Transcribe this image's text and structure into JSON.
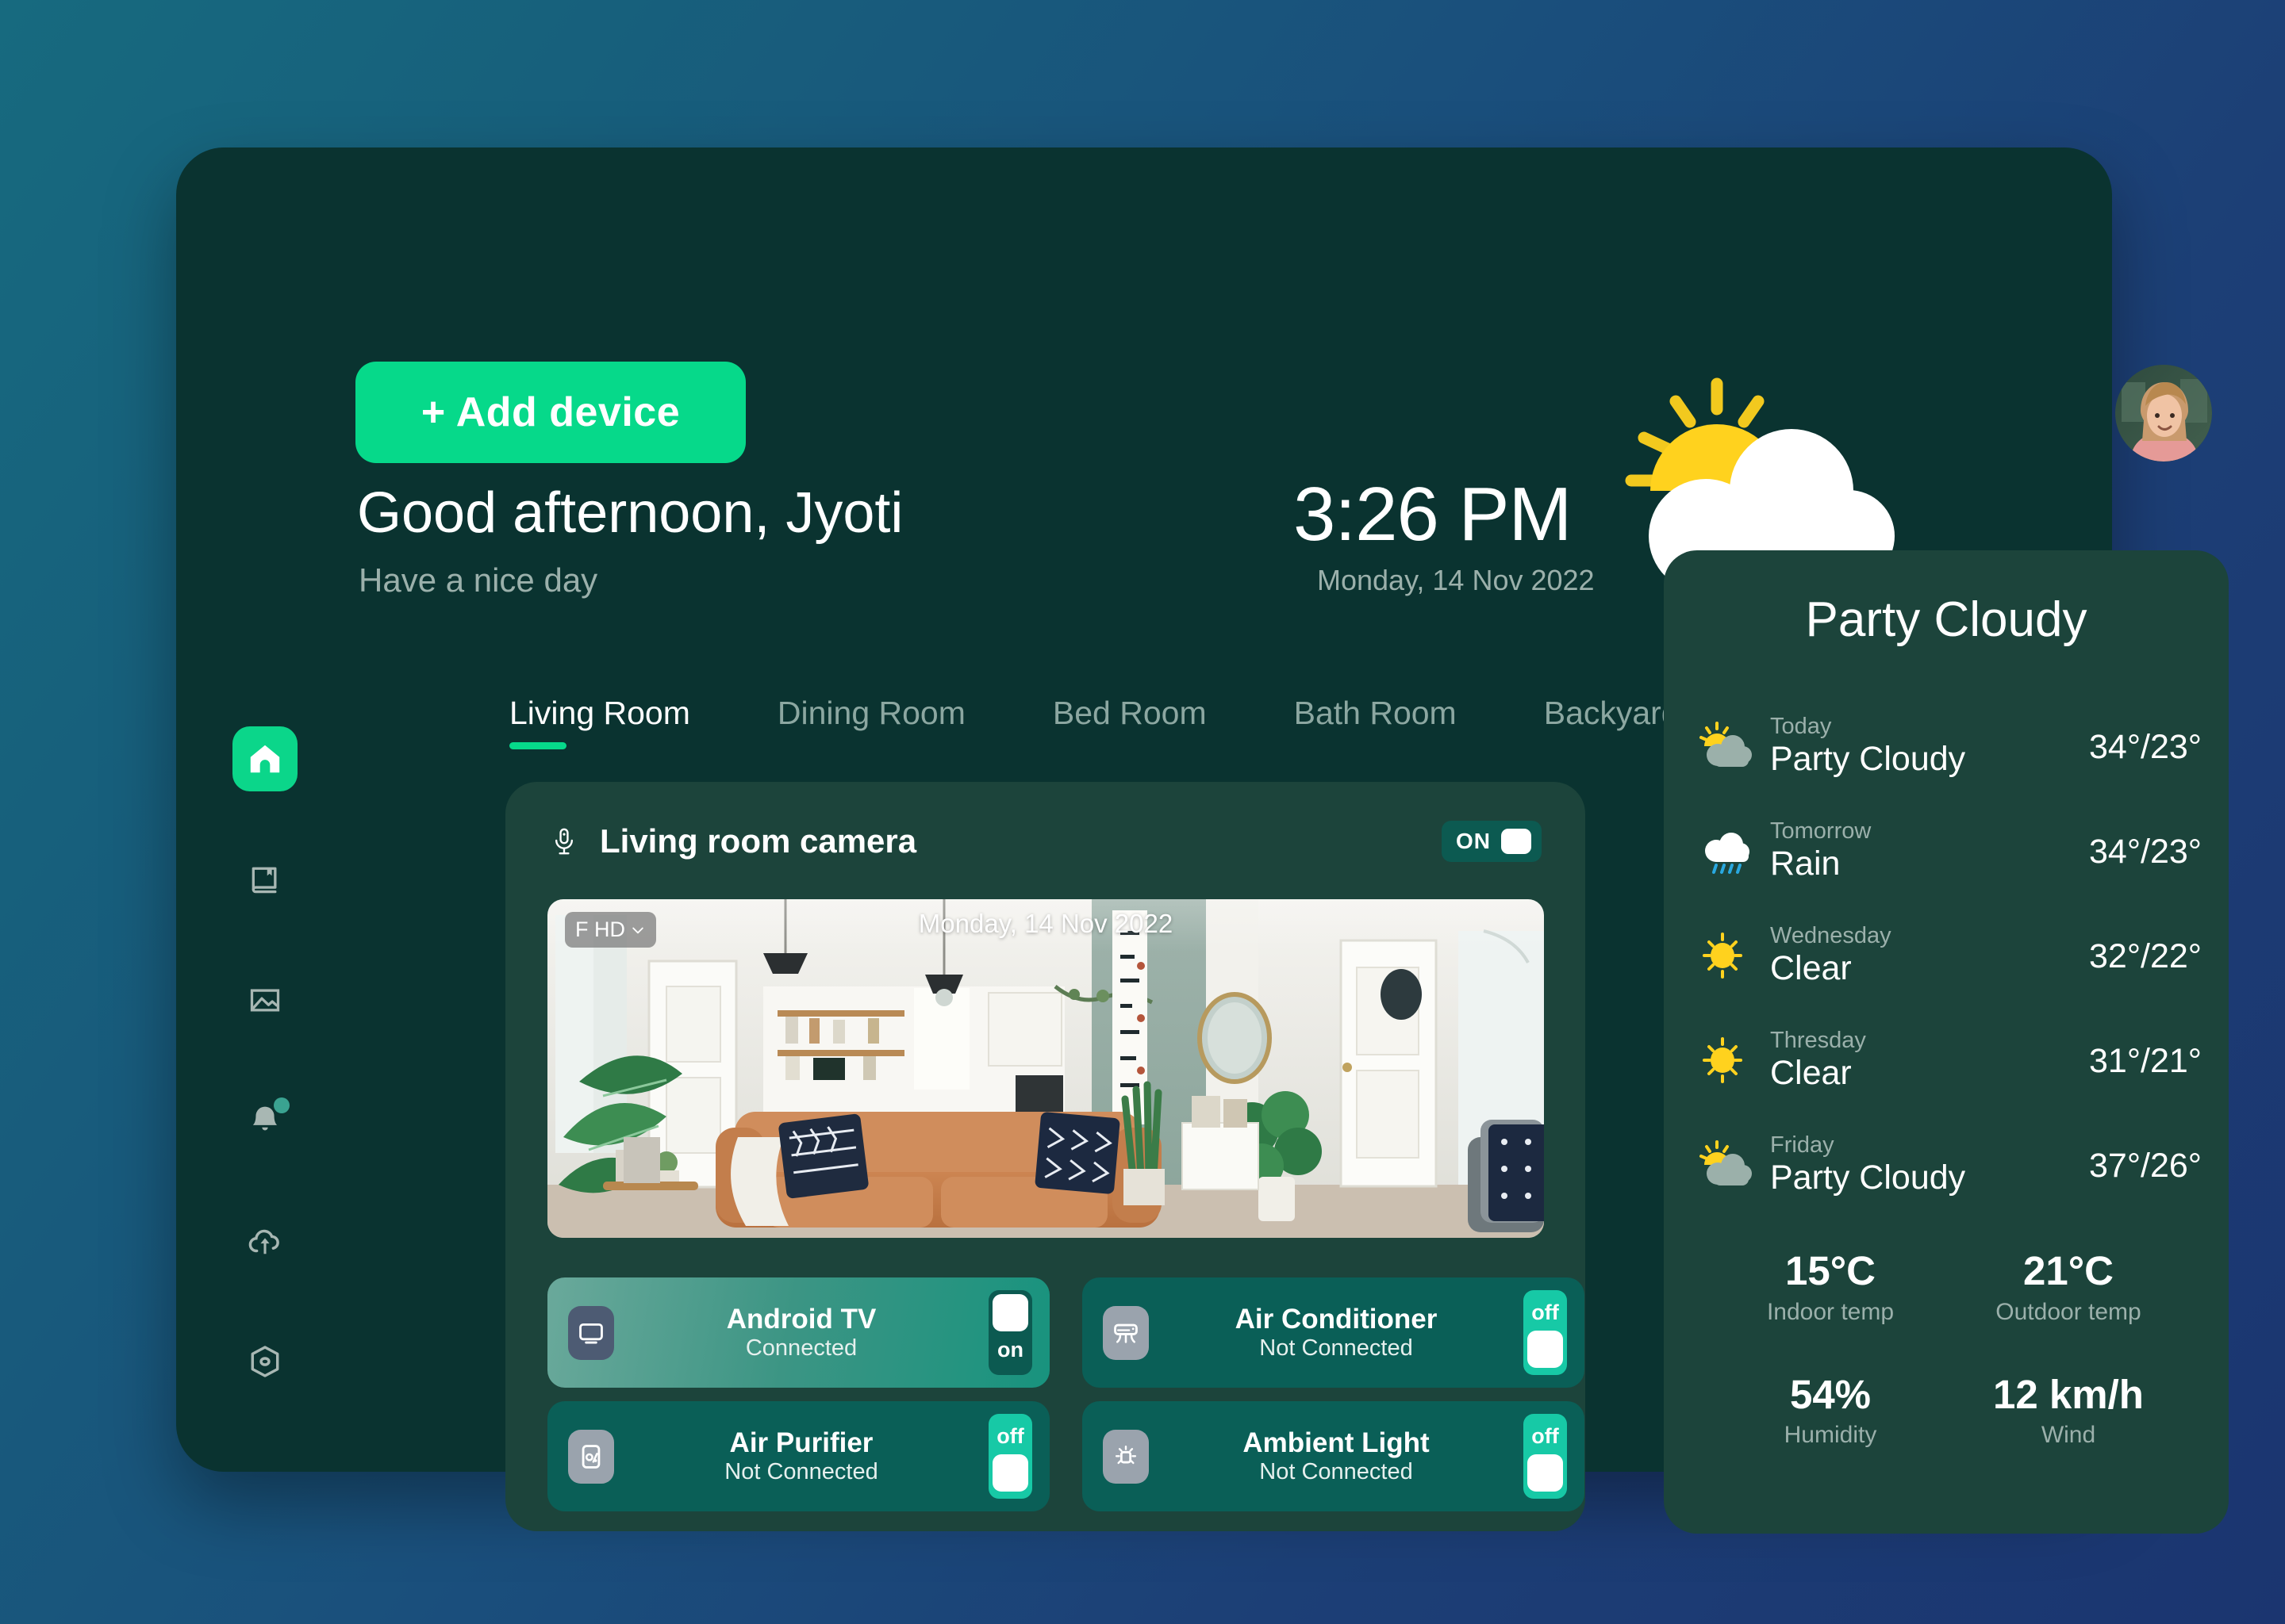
{
  "header": {
    "add_device_label": "+ Add device",
    "greeting": "Good afternoon, Jyoti",
    "subgreeting": "Have a nice day",
    "time": "3:26 PM",
    "date": "Monday, 14 Nov 2022",
    "hero_weather_icon": "sun-behind-cloud-icon",
    "avatar_icon": "user-avatar"
  },
  "sidebar": {
    "items": [
      {
        "name": "home",
        "icon": "home-icon",
        "active": true,
        "badge": false
      },
      {
        "name": "library",
        "icon": "book-icon",
        "active": false,
        "badge": false
      },
      {
        "name": "gallery",
        "icon": "image-icon",
        "active": false,
        "badge": false
      },
      {
        "name": "notifications",
        "icon": "bell-icon",
        "active": false,
        "badge": true
      },
      {
        "name": "cloud-upload",
        "icon": "cloud-upload-icon",
        "active": false,
        "badge": false
      },
      {
        "name": "settings",
        "icon": "settings-hexagon-icon",
        "active": false,
        "badge": false
      }
    ]
  },
  "rooms": {
    "tabs": [
      {
        "label": "Living Room",
        "active": true
      },
      {
        "label": "Dining Room",
        "active": false
      },
      {
        "label": "Bed Room",
        "active": false
      },
      {
        "label": "Bath Room",
        "active": false
      },
      {
        "label": "Backyard",
        "active": false
      }
    ]
  },
  "camera": {
    "mic_icon": "microphone-icon",
    "title": "Living room camera",
    "power_label": "ON",
    "power_state": "on",
    "quality_badge": "F HD",
    "quality_chevron": "chevron-down-icon",
    "feed_timestamp": "Monday, 14 Nov 2022"
  },
  "devices": [
    {
      "name": "Android TV",
      "status": "Connected",
      "state": "on",
      "toggle_label": "on",
      "icon": "tv-icon"
    },
    {
      "name": "Air Conditioner",
      "status": "Not Connected",
      "state": "off",
      "toggle_label": "off",
      "icon": "air-conditioner-icon"
    },
    {
      "name": "Air Purifier",
      "status": "Not Connected",
      "state": "off",
      "toggle_label": "off",
      "icon": "air-purifier-icon"
    },
    {
      "name": "Ambient Light",
      "status": "Not Connected",
      "state": "off",
      "toggle_label": "off",
      "icon": "ambient-light-icon"
    }
  ],
  "weather": {
    "headline": "Party Cloudy",
    "forecast": [
      {
        "day": "Today",
        "condition": "Party Cloudy",
        "temp": "34°/23°",
        "icon": "sun-behind-cloud-icon"
      },
      {
        "day": "Tomorrow",
        "condition": "Rain",
        "temp": "34°/23°",
        "icon": "rain-cloud-icon"
      },
      {
        "day": "Wednesday",
        "condition": "Clear",
        "temp": "32°/22°",
        "icon": "sun-icon"
      },
      {
        "day": "Thresday",
        "condition": "Clear",
        "temp": "31°/21°",
        "icon": "sun-icon"
      },
      {
        "day": "Friday",
        "condition": "Party Cloudy",
        "temp": "37°/26°",
        "icon": "sun-behind-cloud-icon"
      }
    ],
    "stats": [
      {
        "value": "15°C",
        "label": "Indoor temp"
      },
      {
        "value": "21°C",
        "label": "Outdoor temp"
      },
      {
        "value": "54%",
        "label": "Humidity"
      },
      {
        "value": "12 km/h",
        "label": "Wind"
      }
    ]
  },
  "colors": {
    "accent_green": "#06d98a",
    "app_bg": "#0a3330",
    "card_bg": "#1c443b",
    "device_off_bg": "#0a5f57",
    "toggle_off_bg": "#17c9a6",
    "sun_yellow": "#ffd21e",
    "muted_text": "#9bb0ab"
  }
}
